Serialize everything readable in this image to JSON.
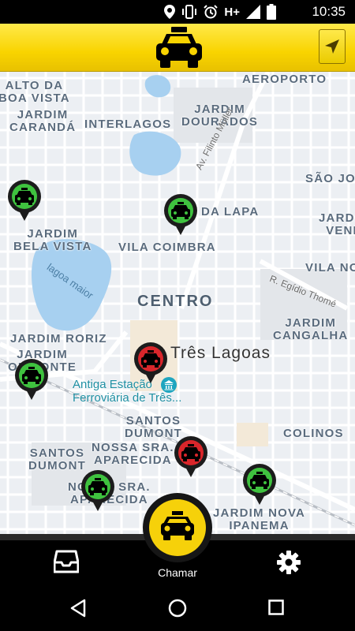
{
  "status_bar": {
    "network": "H+",
    "time": "10:35"
  },
  "map": {
    "neighborhoods": [
      {
        "id": "alto-da-boa-vista",
        "text": "ALTO DA\nBOA VISTA"
      },
      {
        "id": "aeroporto",
        "text": "AEROPORTO"
      },
      {
        "id": "jardim-caranda",
        "text": "JARDIM\nCARANDÁ"
      },
      {
        "id": "interlagos",
        "text": "INTERLAGOS"
      },
      {
        "id": "jardim-dourados",
        "text": "JARDIM\nDOURADOS"
      },
      {
        "id": "sao-jo",
        "text": "SÃO JO"
      },
      {
        "id": "da-lapa",
        "text": "DA LAPA"
      },
      {
        "id": "jardim-vend",
        "text": "JARDIM\nVEND"
      },
      {
        "id": "jardim-bela-vista",
        "text": "JARDIM\nBELA VISTA"
      },
      {
        "id": "vila-coimbra",
        "text": "VILA COIMBRA"
      },
      {
        "id": "vila-no",
        "text": "VILA NO"
      },
      {
        "id": "jardim-cangalha",
        "text": "JARDIM\nCANGALHA"
      },
      {
        "id": "jardim-roriz",
        "text": "JARDIM RORIZ"
      },
      {
        "id": "jardim-orizonte",
        "text": "JARDIM\nORIZONTE"
      },
      {
        "id": "santos-dumont-1",
        "text": "SANTOS\nDUMONT"
      },
      {
        "id": "colinos",
        "text": "COLINOS"
      },
      {
        "id": "nossa-sra-aparecida-1",
        "text": "NOSSA SRA.\nAPARECIDA"
      },
      {
        "id": "santos-dumont-2",
        "text": "SANTOS\nDUMONT"
      },
      {
        "id": "nossa-sra-aparecida-2",
        "text": "NOSSA SRA.\nAPARECIDA"
      },
      {
        "id": "jardim-nova-ipanema",
        "text": "JARDIM NOVA\nIPANEMA"
      }
    ],
    "streets": [
      {
        "id": "av-filinto-muller",
        "text": "Av. Filinto Müller"
      },
      {
        "id": "r-egidio-thome",
        "text": "R. Egídio Thomé"
      }
    ],
    "district": "CENTRO",
    "city": "Três Lagoas",
    "lake": "lagoa maior",
    "poi": "Antiga Estação\nFerroviária de Três...",
    "taxis": [
      {
        "id": "taxi-1",
        "status": "available",
        "color": "#3fc23f"
      },
      {
        "id": "taxi-2",
        "status": "available",
        "color": "#3fc23f"
      },
      {
        "id": "taxi-3",
        "status": "busy",
        "color": "#d9262b"
      },
      {
        "id": "taxi-4",
        "status": "available",
        "color": "#3fc23f"
      },
      {
        "id": "taxi-5",
        "status": "busy",
        "color": "#d9262b"
      },
      {
        "id": "taxi-6",
        "status": "available",
        "color": "#3fc23f"
      },
      {
        "id": "taxi-7",
        "status": "available",
        "color": "#3fc23f"
      }
    ]
  },
  "bottom_nav": {
    "call_label": "Chamar",
    "inbox_icon": "inbox-icon",
    "settings_icon": "gear-icon"
  },
  "colors": {
    "header_yellow": "#f9d400",
    "accent_yellow": "#f6d10a",
    "available_green": "#3fc23f",
    "busy_red": "#d9262b"
  }
}
